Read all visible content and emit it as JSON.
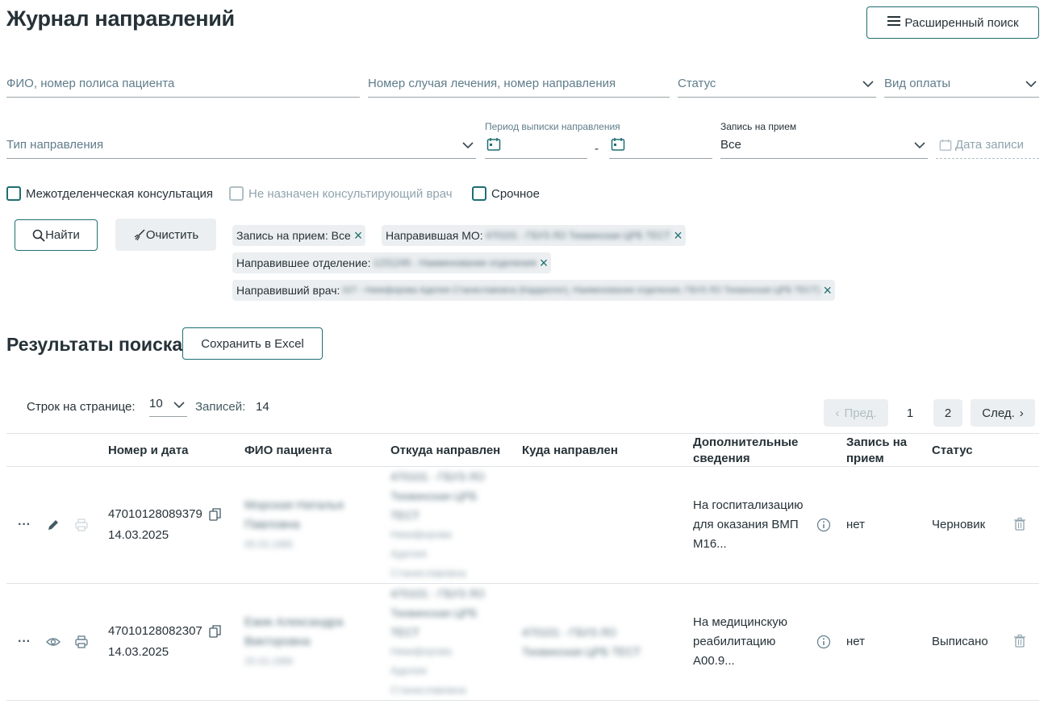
{
  "header": {
    "title": "Журнал направлений",
    "advanced_search_label": "Расширенный поиск"
  },
  "filters": {
    "patient_placeholder": "ФИО, номер полиса пациента",
    "case_placeholder": "Номер случая лечения, номер направления",
    "status_placeholder": "Статус",
    "payment_placeholder": "Вид оплаты",
    "type_placeholder": "Тип направления",
    "period_label": "Период выписки направления",
    "period_separator": "-",
    "appointment_label": "Запись на прием",
    "appointment_value": "Все",
    "record_date_placeholder": "Дата записи",
    "checkbox_interdept": "Межотделенческая консультация",
    "checkbox_no_doctor": "Не назначен консультирующий врач",
    "checkbox_urgent": "Срочное",
    "find_label": "Найти",
    "clear_label": "Очистить"
  },
  "chips": [
    {
      "label": "Запись на прием: Все",
      "value": ""
    },
    {
      "label": "Направившая МО:",
      "value": "470101 - ГБУЗ ЛО Тихвинская ЦРБ ТЕСТ"
    },
    {
      "label": "Направившее отделение:",
      "value": "1231245 - Наименование отделения"
    },
    {
      "label": "Направивший врач:",
      "value": "027 - Никифорова Аделия Станиславовна (Кардиолог), Наименование отделения, ГБУЗ ЛО Тихвинская ЦРБ ТЕСТ)"
    }
  ],
  "results": {
    "title": "Результаты поиска",
    "excel_label": "Сохранить в Excel",
    "rows_per_page_label": "Строк на странице:",
    "rows_per_page_value": "10",
    "records_label": "Записей:",
    "records_value": "14",
    "pager": {
      "prev": "Пред.",
      "next": "След.",
      "pages": [
        "1",
        "2"
      ],
      "current": "1"
    }
  },
  "table": {
    "columns": [
      "Номер и дата",
      "ФИО пациента",
      "Откуда направлен",
      "Куда направлен",
      "Дополнительные сведения",
      "Запись на прием",
      "Статус"
    ],
    "rows": [
      {
        "number": "47010128089379",
        "date": "14.03.2025",
        "patient_name": "Морская Наталья Павловна",
        "patient_dob": "05.03.1985",
        "from_org": "470101 - ГБУЗ ЛО Тихвинская ЦРБ ТЕСТ",
        "from_doctor": "Никифорова Аделия Станиславовна",
        "to": "",
        "info": "На госпитализацию для оказания ВМП М16...",
        "appointment": "нет",
        "status": "Черновик",
        "mode_icon": "edit-icon"
      },
      {
        "number": "47010128082307",
        "date": "14.03.2025",
        "patient_name": "Ежик Александра Викторовна",
        "patient_dob": "25.03.1989",
        "from_org": "470101 - ГБУЗ ЛО Тихвинская ЦРБ ТЕСТ",
        "from_doctor": "Никифорова Аделия Станиславовна",
        "to": "470101 - ГБУЗ ЛО Тихвинская ЦРБ ТЕСТ",
        "info": "На медицинскую реабилитацию A00.9...",
        "appointment": "нет",
        "status": "Выписано",
        "mode_icon": "eye-icon"
      }
    ]
  },
  "colors": {
    "accent": "#1f6e72",
    "text": "#263238",
    "muted": "#607d8b",
    "chip_bg": "#eceff1"
  }
}
